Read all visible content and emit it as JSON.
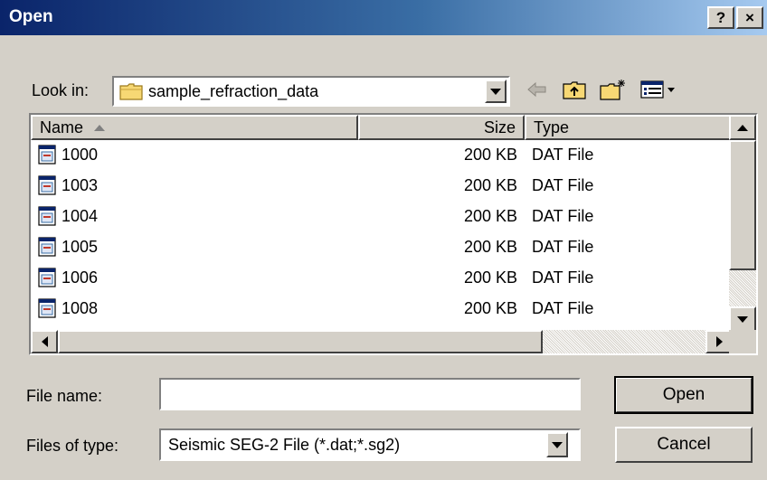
{
  "window": {
    "title": "Open",
    "help_label": "?",
    "close_label": "×"
  },
  "lookin": {
    "label": "Look in:",
    "folder": "sample_refraction_data"
  },
  "toolbar": [
    "back-icon",
    "up-folder-icon",
    "new-folder-icon",
    "view-menu-icon"
  ],
  "list": {
    "columns": {
      "name": "Name",
      "size": "Size",
      "type": "Type"
    },
    "rows": [
      {
        "name": "1000",
        "size": "200 KB",
        "type": "DAT File"
      },
      {
        "name": "1003",
        "size": "200 KB",
        "type": "DAT File"
      },
      {
        "name": "1004",
        "size": "200 KB",
        "type": "DAT File"
      },
      {
        "name": "1005",
        "size": "200 KB",
        "type": "DAT File"
      },
      {
        "name": "1006",
        "size": "200 KB",
        "type": "DAT File"
      },
      {
        "name": "1008",
        "size": "200 KB",
        "type": "DAT File"
      }
    ]
  },
  "filename": {
    "label": "File name:",
    "value": ""
  },
  "filetype": {
    "label": "Files of type:",
    "value": "Seismic SEG-2 File (*.dat;*.sg2)"
  },
  "buttons": {
    "open": "Open",
    "cancel": "Cancel"
  },
  "colors": {
    "titlebar_start": "#0a246a",
    "titlebar_end": "#a6caf0",
    "face": "#d4d0c8"
  }
}
